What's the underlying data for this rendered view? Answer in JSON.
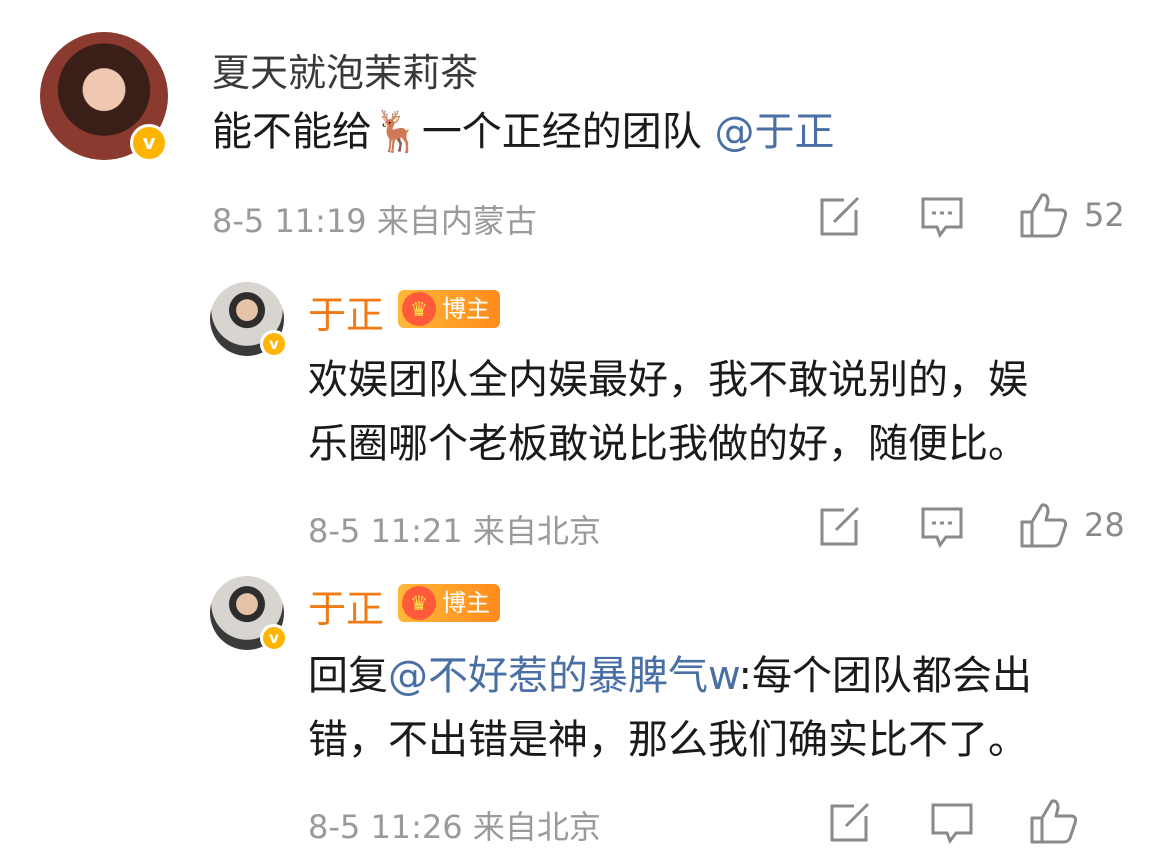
{
  "comments": [
    {
      "author": "夏天就泡茉莉茶",
      "text_before": "能不能给",
      "emoji": "🦌",
      "text_after": "一个正经的团队 ",
      "mention": "@于正",
      "meta": "8-5 11:19 来自内蒙古",
      "likes": "52"
    },
    {
      "author": "于正",
      "badge": "博主",
      "line1": "欢娱团队全内娱最好，我不敢说别的，娱",
      "line2": "乐圈哪个老板敢说比我做的好，随便比。",
      "meta": "8-5 11:21 来自北京",
      "likes": "28"
    },
    {
      "author": "于正",
      "badge": "博主",
      "prefix": "回复",
      "mention": "@不好惹的暴脾气w",
      "line1_rest": ":每个团队都会出",
      "line2": "错，不出错是神，那么我们确实比不了。",
      "meta": "8-5 11:26 来自北京"
    }
  ],
  "icons": [
    "share-icon",
    "comment-icon",
    "like-icon"
  ],
  "colors": {
    "author_orange": "#f07a14",
    "mention_blue": "#4a6fa5",
    "meta_gray": "#9a9a9a",
    "badge_gold": "#ffb400"
  }
}
